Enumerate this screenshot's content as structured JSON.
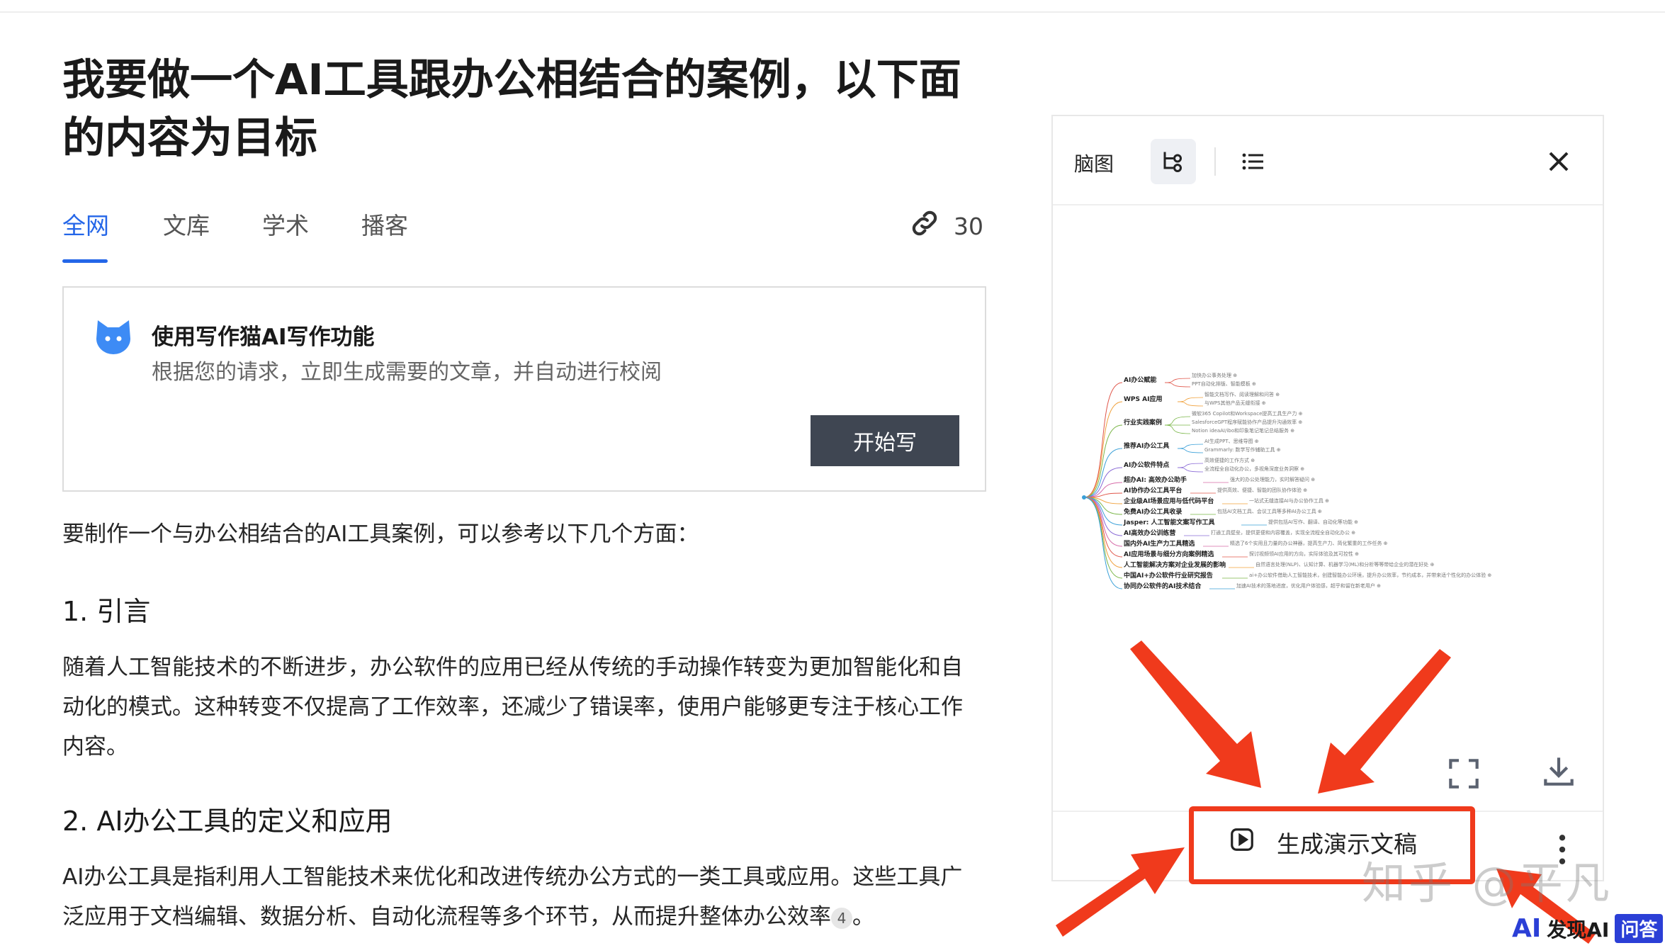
{
  "title": "我要做一个AI工具跟办公相结合的案例，以下面的内容为目标",
  "tabs": [
    {
      "label": "全网",
      "active": true
    },
    {
      "label": "文库",
      "active": false
    },
    {
      "label": "学术",
      "active": false
    },
    {
      "label": "播客",
      "active": false
    }
  ],
  "sources_count": "30",
  "writer_card": {
    "title": "使用写作猫AI写作功能",
    "subtitle": "根据您的请求，立即生成需要的文章，并自动进行校阅",
    "button": "开始写"
  },
  "article": {
    "intro": "要制作一个与办公相结合的AI工具案例，可以参考以下几个方面：",
    "h1": "1. 引言",
    "p1": "随着人工智能技术的不断进步，办公软件的应用已经从传统的手动操作转变为更加智能化和自动化的模式。这种转变不仅提高了工作效率，还减少了错误率，使用户能够更专注于核心工作内容。",
    "h2": "2. AI办公工具的定义和应用",
    "p2": "AI办公工具是指利用人工智能技术来优化和改进传统办公方式的一类工具或应用。这些工具广泛应用于文档编辑、数据分析、自动化流程等多个环节，从而提升整体办公效率",
    "p2_cite": "4",
    "p2_end": "。"
  },
  "panel": {
    "label": "脑图",
    "generate_button": "生成演示文稿",
    "mindmap": [
      {
        "node": "AI办公赋能",
        "leaves": [
          "加快办公事务处理",
          "PPT自动化排版、智能模板"
        ]
      },
      {
        "node": "WPS AI应用",
        "leaves": [
          "智能文档写作、阅读理解和问答",
          "与WPS其他产品无缝衔接"
        ]
      },
      {
        "node": "行业实践案例",
        "leaves": [
          "微软365 Copilot和Workspace提高工具生产力",
          "SalesforceGPT程序赋能协作产品提升沟通效率",
          "Notion ideaAI/ibo和印象笔记笔记总结服务"
        ]
      },
      {
        "node": "推荐AI办公工具",
        "leaves": [
          "AI生成PPT、思维导图",
          "Grammarly: 数学写作辅助工具"
        ]
      },
      {
        "node": "AI办公软件特点",
        "leaves": [
          "高效便捷的工作方式",
          "全流程全自动化办公，多视角深度业务洞察"
        ]
      },
      {
        "node": "超办AI: 高效办公助手",
        "leaves": [
          "强大的办公处理能力，实时解答疑问"
        ]
      },
      {
        "node": "AI协作办公工具平台",
        "leaves": [
          "提供高效、便捷、智能的团队协作体验"
        ]
      },
      {
        "node": "企业级AI场景应用与低代码平台",
        "leaves": [
          "一站式无缝连接AI与办公协作工具"
        ]
      },
      {
        "node": "免费AI办公工具收录",
        "leaves": [
          "包括AI文档工具、会议工具等多种AI办公工具"
        ]
      },
      {
        "node": "Jasper: 人工智能文案写作工具",
        "leaves": [
          "提供包括AI写作、翻译、自动化等功能"
        ]
      },
      {
        "node": "AI高效办公训练营",
        "leaves": [
          "打通工具壁垒，提供更便和内容覆盖，实现全流程全自动化办公"
        ]
      },
      {
        "node": "国内外AI生产力工具精选",
        "leaves": [
          "精选了6个实用且力量的办公神器，提高生产力、简化繁重的工作任务"
        ]
      },
      {
        "node": "AI应用场景与细分方向案例精选",
        "leaves": [
          "探讨视频领AI应用的方向，实际体验及其可控性"
        ]
      },
      {
        "node": "人工智能解决方案对企业发展的影响",
        "leaves": [
          "自然语言处理(NLP)、认知计算、机器学习(ML)和分析等等带给企业的潜在好处"
        ]
      },
      {
        "node": "中国AI+办公软件行业研究报告",
        "leaves": [
          "ai+办公软件借助人工智能技术，创建智能办公环境，提升办公效率，节约成本，并带来适个性化的办公体验"
        ]
      },
      {
        "node": "协同办公软件的AI技术结合",
        "leaves": [
          "加速AI技术的落地进度，优化用户体验感，超乎和留在新老用户"
        ]
      }
    ]
  },
  "watermark": "知乎 @平凡",
  "brand": {
    "ai": "AI",
    "name": "发现AI",
    "tag": "问答"
  },
  "colors": {
    "accent": "#2466e8",
    "highlight": "#f03a1c",
    "button_dark": "#3f4652"
  }
}
